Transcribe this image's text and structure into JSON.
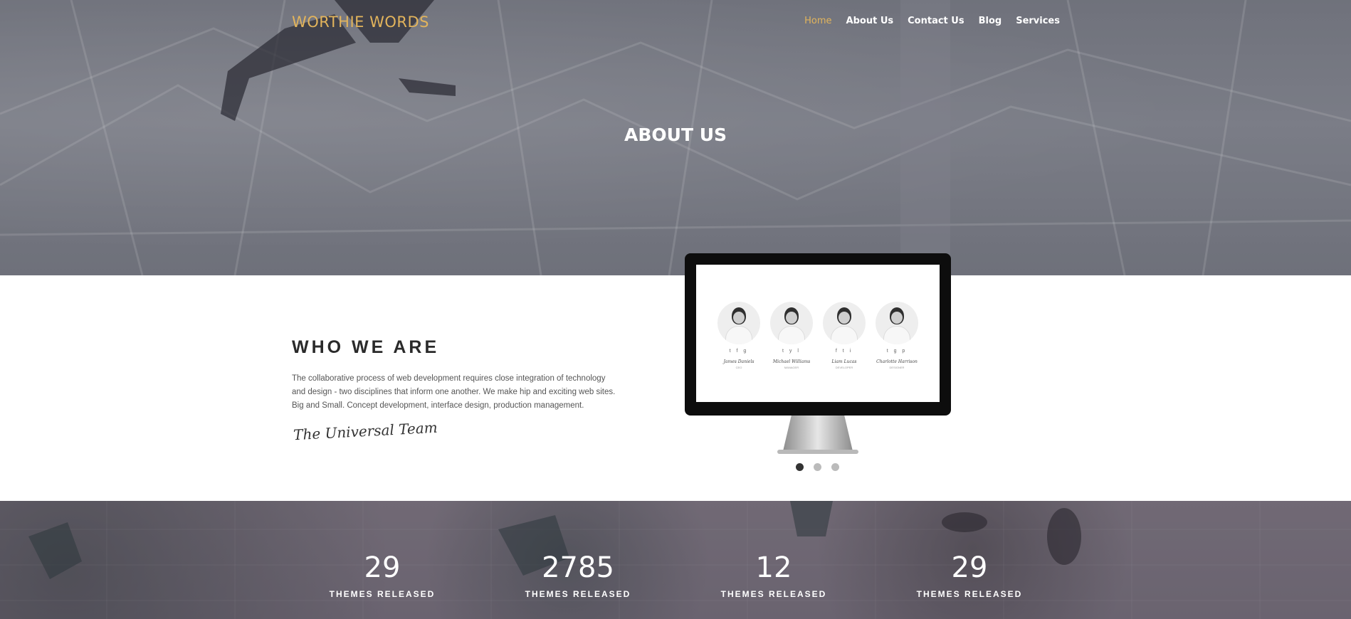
{
  "header": {
    "logo": "WORTHIE WORDS",
    "nav": [
      "Home",
      "About Us",
      "Contact Us",
      "Blog",
      "Services"
    ],
    "active_nav": "Home"
  },
  "hero": {
    "title": "ABOUT US"
  },
  "about": {
    "title": "WHO WE ARE",
    "text": "The collaborative process of web development requires close integration of technology and design - two disciplines that inform one another. We make hip and exciting web sites. Big and Small. Concept development, interface design, production management.",
    "signature": "The Universal Team"
  },
  "slider": {
    "team": [
      {
        "name": "James Daniels",
        "role": "CEO",
        "social": "t f g"
      },
      {
        "name": "Michael Williams",
        "role": "MANAGER",
        "social": "t y l"
      },
      {
        "name": "Liam Lucas",
        "role": "DEVELOPER",
        "social": "f t i"
      },
      {
        "name": "Charlotte Harrison",
        "role": "DESIGNER",
        "social": "t g p"
      }
    ],
    "dots": 3,
    "active_dot": 0
  },
  "stats": [
    {
      "value": "29",
      "label": "THEMES RELEASED"
    },
    {
      "value": "2785",
      "label": "THEMES RELEASED"
    },
    {
      "value": "12",
      "label": "THEMES RELEASED"
    },
    {
      "value": "29",
      "label": "THEMES RELEASED"
    }
  ],
  "colors": {
    "accent": "#e2b45c",
    "heading": "#2a2a2a",
    "text": "#555555"
  }
}
